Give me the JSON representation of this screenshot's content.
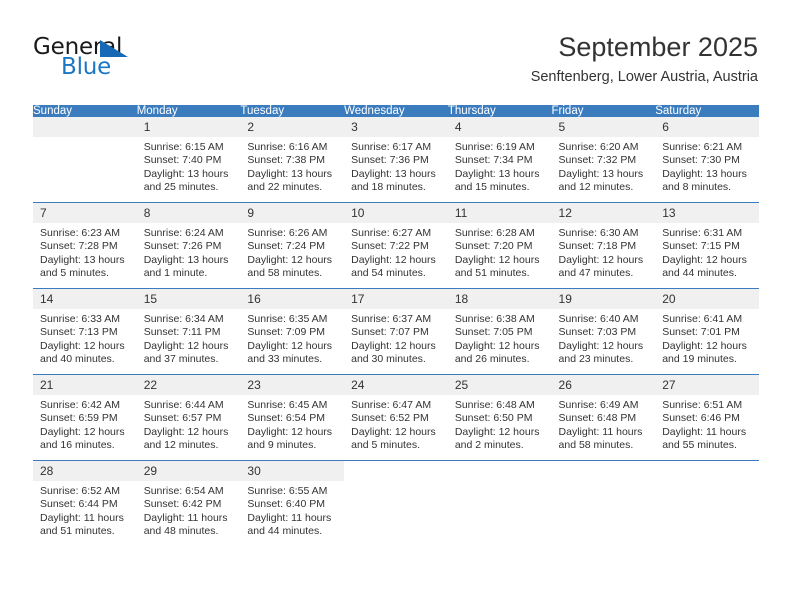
{
  "brand": {
    "name_part1": "General",
    "name_part2": "Blue",
    "triangle_color": "#1669b5",
    "blue_color": "#1b76c4"
  },
  "header": {
    "title": "September 2025",
    "subtitle": "Senftenberg, Lower Austria, Austria"
  },
  "calendar": {
    "header_bg": "#3b7cbf",
    "daynum_bg": "#f0f0f0",
    "weekdays": [
      "Sunday",
      "Monday",
      "Tuesday",
      "Wednesday",
      "Thursday",
      "Friday",
      "Saturday"
    ],
    "weeks": [
      [
        {
          "day": "",
          "sunrise": "",
          "sunset": "",
          "daylight_line1": "",
          "daylight_line2": ""
        },
        {
          "day": "1",
          "sunrise": "Sunrise: 6:15 AM",
          "sunset": "Sunset: 7:40 PM",
          "daylight_line1": "Daylight: 13 hours",
          "daylight_line2": "and 25 minutes."
        },
        {
          "day": "2",
          "sunrise": "Sunrise: 6:16 AM",
          "sunset": "Sunset: 7:38 PM",
          "daylight_line1": "Daylight: 13 hours",
          "daylight_line2": "and 22 minutes."
        },
        {
          "day": "3",
          "sunrise": "Sunrise: 6:17 AM",
          "sunset": "Sunset: 7:36 PM",
          "daylight_line1": "Daylight: 13 hours",
          "daylight_line2": "and 18 minutes."
        },
        {
          "day": "4",
          "sunrise": "Sunrise: 6:19 AM",
          "sunset": "Sunset: 7:34 PM",
          "daylight_line1": "Daylight: 13 hours",
          "daylight_line2": "and 15 minutes."
        },
        {
          "day": "5",
          "sunrise": "Sunrise: 6:20 AM",
          "sunset": "Sunset: 7:32 PM",
          "daylight_line1": "Daylight: 13 hours",
          "daylight_line2": "and 12 minutes."
        },
        {
          "day": "6",
          "sunrise": "Sunrise: 6:21 AM",
          "sunset": "Sunset: 7:30 PM",
          "daylight_line1": "Daylight: 13 hours",
          "daylight_line2": "and 8 minutes."
        }
      ],
      [
        {
          "day": "7",
          "sunrise": "Sunrise: 6:23 AM",
          "sunset": "Sunset: 7:28 PM",
          "daylight_line1": "Daylight: 13 hours",
          "daylight_line2": "and 5 minutes."
        },
        {
          "day": "8",
          "sunrise": "Sunrise: 6:24 AM",
          "sunset": "Sunset: 7:26 PM",
          "daylight_line1": "Daylight: 13 hours",
          "daylight_line2": "and 1 minute."
        },
        {
          "day": "9",
          "sunrise": "Sunrise: 6:26 AM",
          "sunset": "Sunset: 7:24 PM",
          "daylight_line1": "Daylight: 12 hours",
          "daylight_line2": "and 58 minutes."
        },
        {
          "day": "10",
          "sunrise": "Sunrise: 6:27 AM",
          "sunset": "Sunset: 7:22 PM",
          "daylight_line1": "Daylight: 12 hours",
          "daylight_line2": "and 54 minutes."
        },
        {
          "day": "11",
          "sunrise": "Sunrise: 6:28 AM",
          "sunset": "Sunset: 7:20 PM",
          "daylight_line1": "Daylight: 12 hours",
          "daylight_line2": "and 51 minutes."
        },
        {
          "day": "12",
          "sunrise": "Sunrise: 6:30 AM",
          "sunset": "Sunset: 7:18 PM",
          "daylight_line1": "Daylight: 12 hours",
          "daylight_line2": "and 47 minutes."
        },
        {
          "day": "13",
          "sunrise": "Sunrise: 6:31 AM",
          "sunset": "Sunset: 7:15 PM",
          "daylight_line1": "Daylight: 12 hours",
          "daylight_line2": "and 44 minutes."
        }
      ],
      [
        {
          "day": "14",
          "sunrise": "Sunrise: 6:33 AM",
          "sunset": "Sunset: 7:13 PM",
          "daylight_line1": "Daylight: 12 hours",
          "daylight_line2": "and 40 minutes."
        },
        {
          "day": "15",
          "sunrise": "Sunrise: 6:34 AM",
          "sunset": "Sunset: 7:11 PM",
          "daylight_line1": "Daylight: 12 hours",
          "daylight_line2": "and 37 minutes."
        },
        {
          "day": "16",
          "sunrise": "Sunrise: 6:35 AM",
          "sunset": "Sunset: 7:09 PM",
          "daylight_line1": "Daylight: 12 hours",
          "daylight_line2": "and 33 minutes."
        },
        {
          "day": "17",
          "sunrise": "Sunrise: 6:37 AM",
          "sunset": "Sunset: 7:07 PM",
          "daylight_line1": "Daylight: 12 hours",
          "daylight_line2": "and 30 minutes."
        },
        {
          "day": "18",
          "sunrise": "Sunrise: 6:38 AM",
          "sunset": "Sunset: 7:05 PM",
          "daylight_line1": "Daylight: 12 hours",
          "daylight_line2": "and 26 minutes."
        },
        {
          "day": "19",
          "sunrise": "Sunrise: 6:40 AM",
          "sunset": "Sunset: 7:03 PM",
          "daylight_line1": "Daylight: 12 hours",
          "daylight_line2": "and 23 minutes."
        },
        {
          "day": "20",
          "sunrise": "Sunrise: 6:41 AM",
          "sunset": "Sunset: 7:01 PM",
          "daylight_line1": "Daylight: 12 hours",
          "daylight_line2": "and 19 minutes."
        }
      ],
      [
        {
          "day": "21",
          "sunrise": "Sunrise: 6:42 AM",
          "sunset": "Sunset: 6:59 PM",
          "daylight_line1": "Daylight: 12 hours",
          "daylight_line2": "and 16 minutes."
        },
        {
          "day": "22",
          "sunrise": "Sunrise: 6:44 AM",
          "sunset": "Sunset: 6:57 PM",
          "daylight_line1": "Daylight: 12 hours",
          "daylight_line2": "and 12 minutes."
        },
        {
          "day": "23",
          "sunrise": "Sunrise: 6:45 AM",
          "sunset": "Sunset: 6:54 PM",
          "daylight_line1": "Daylight: 12 hours",
          "daylight_line2": "and 9 minutes."
        },
        {
          "day": "24",
          "sunrise": "Sunrise: 6:47 AM",
          "sunset": "Sunset: 6:52 PM",
          "daylight_line1": "Daylight: 12 hours",
          "daylight_line2": "and 5 minutes."
        },
        {
          "day": "25",
          "sunrise": "Sunrise: 6:48 AM",
          "sunset": "Sunset: 6:50 PM",
          "daylight_line1": "Daylight: 12 hours",
          "daylight_line2": "and 2 minutes."
        },
        {
          "day": "26",
          "sunrise": "Sunrise: 6:49 AM",
          "sunset": "Sunset: 6:48 PM",
          "daylight_line1": "Daylight: 11 hours",
          "daylight_line2": "and 58 minutes."
        },
        {
          "day": "27",
          "sunrise": "Sunrise: 6:51 AM",
          "sunset": "Sunset: 6:46 PM",
          "daylight_line1": "Daylight: 11 hours",
          "daylight_line2": "and 55 minutes."
        }
      ],
      [
        {
          "day": "28",
          "sunrise": "Sunrise: 6:52 AM",
          "sunset": "Sunset: 6:44 PM",
          "daylight_line1": "Daylight: 11 hours",
          "daylight_line2": "and 51 minutes."
        },
        {
          "day": "29",
          "sunrise": "Sunrise: 6:54 AM",
          "sunset": "Sunset: 6:42 PM",
          "daylight_line1": "Daylight: 11 hours",
          "daylight_line2": "and 48 minutes."
        },
        {
          "day": "30",
          "sunrise": "Sunrise: 6:55 AM",
          "sunset": "Sunset: 6:40 PM",
          "daylight_line1": "Daylight: 11 hours",
          "daylight_line2": "and 44 minutes."
        },
        {
          "day": "",
          "sunrise": "",
          "sunset": "",
          "daylight_line1": "",
          "daylight_line2": ""
        },
        {
          "day": "",
          "sunrise": "",
          "sunset": "",
          "daylight_line1": "",
          "daylight_line2": ""
        },
        {
          "day": "",
          "sunrise": "",
          "sunset": "",
          "daylight_line1": "",
          "daylight_line2": ""
        },
        {
          "day": "",
          "sunrise": "",
          "sunset": "",
          "daylight_line1": "",
          "daylight_line2": ""
        }
      ]
    ]
  }
}
